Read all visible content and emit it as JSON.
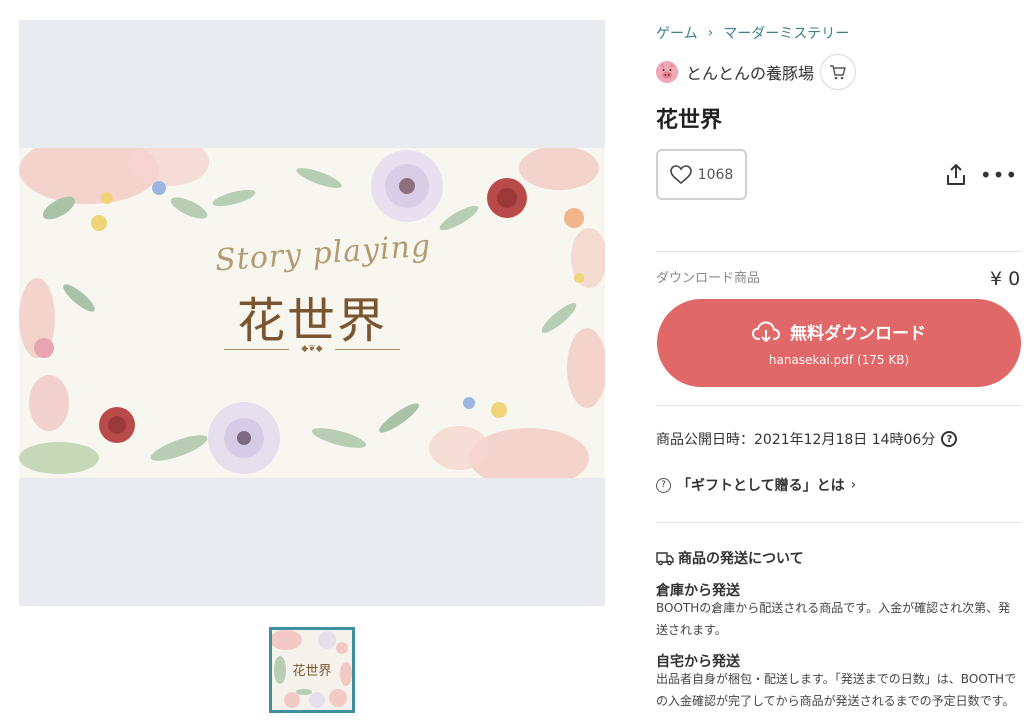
{
  "breadcrumb": {
    "category": "ゲーム",
    "separator": "›",
    "subcategory": "マーダーミステリー"
  },
  "shop": {
    "name": "とんとんの養豚場",
    "avatar_icon": "pig-icon",
    "cart_icon": "cart-icon"
  },
  "product": {
    "title": "花世界",
    "image": {
      "script_text": "Story playing",
      "title_text": "花世界"
    },
    "thumbnail": {
      "title_text": "花世界"
    }
  },
  "actions": {
    "like_count": "1068",
    "like_icon": "heart-icon",
    "share_icon": "share-icon",
    "more_label": "•••"
  },
  "purchase": {
    "type_label": "ダウンロード商品",
    "price": "¥ 0",
    "button_label": "無料ダウンロード",
    "file_info": "hanasekai.pdf (175 KB)",
    "button_icon": "cloud-download-icon",
    "accent_color": "#e06868"
  },
  "publish": {
    "label": "商品公開日時：2021年12月18日 14時06分",
    "help_icon": "question-icon"
  },
  "gift": {
    "q_icon": "?",
    "label": "「ギフトとして贈る」とは",
    "chevron": "›"
  },
  "shipping": {
    "heading": "商品の発送について",
    "warehouse": {
      "title": "倉庫から発送",
      "desc": "BOOTHの倉庫から配送される商品です。入金が確認され次第、発送されます。"
    },
    "home": {
      "title": "自宅から発送",
      "desc": "出品者自身が梱包・配送します。「発送までの日数」は、BOOTHでの入金確認が完了してから商品が発送されるまでの予定日数です。"
    }
  },
  "colors": {
    "link": "#3d7f8e",
    "thumb_border": "#3f8fa0",
    "button": "#e06868"
  }
}
